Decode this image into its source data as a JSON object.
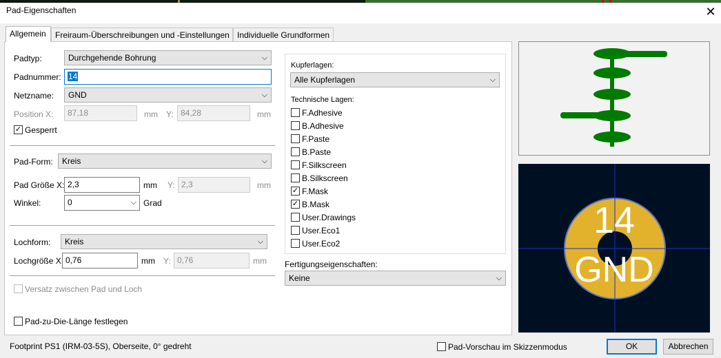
{
  "window": {
    "title": "Pad-Eigenschaften",
    "close_glyph": "✕"
  },
  "tabs": [
    {
      "label": "Allgemein",
      "active": true
    },
    {
      "label": "Freiraum-Überschreibungen und -Einstellungen",
      "active": false
    },
    {
      "label": "Individuelle Grundformen",
      "active": false
    }
  ],
  "general": {
    "padtyp_label": "Padtyp:",
    "padtyp_value": "Durchgehende Bohrung",
    "padnummer_label": "Padnummer:",
    "padnummer_value": "14",
    "netzname_label": "Netzname:",
    "netzname_value": "GND",
    "position_x_label": "Position X:",
    "position_x_value": "87,18",
    "position_x_unit": "mm",
    "position_y_label": "Y:",
    "position_y_value": "84,28",
    "position_y_unit": "mm",
    "gesperrt_label": "Gesperrt",
    "gesperrt_checked": true
  },
  "pad_shape": {
    "form_label": "Pad-Form:",
    "form_value": "Kreis",
    "size_x_label": "Pad Größe X:",
    "size_x_value": "2,3",
    "size_x_unit": "mm",
    "size_y_label": "Y:",
    "size_y_value": "2,3",
    "size_y_unit": "mm",
    "angle_label": "Winkel:",
    "angle_value": "0",
    "angle_unit": "Grad"
  },
  "hole": {
    "form_label": "Lochform:",
    "form_value": "Kreis",
    "size_x_label": "Lochgröße X:",
    "size_x_value": "0,76",
    "size_x_unit": "mm",
    "size_y_label": "Y:",
    "size_y_value": "0,76",
    "size_y_unit": "mm"
  },
  "offset": {
    "label": "Versatz zwischen Pad und Loch",
    "checked": false
  },
  "die_length": {
    "label": "Pad-zu-Die-Länge festlegen",
    "checked": false
  },
  "layers": {
    "copper_label": "Kupferlagen:",
    "copper_value": "Alle Kupferlagen",
    "technical_label": "Technische Lagen:",
    "items": [
      {
        "name": "F.Adhesive",
        "checked": false
      },
      {
        "name": "B.Adhesive",
        "checked": false
      },
      {
        "name": "F.Paste",
        "checked": false
      },
      {
        "name": "B.Paste",
        "checked": false
      },
      {
        "name": "F.Silkscreen",
        "checked": false
      },
      {
        "name": "B.Silkscreen",
        "checked": false
      },
      {
        "name": "F.Mask",
        "checked": true
      },
      {
        "name": "B.Mask",
        "checked": true
      },
      {
        "name": "User.Drawings",
        "checked": false
      },
      {
        "name": "User.Eco1",
        "checked": false
      },
      {
        "name": "User.Eco2",
        "checked": false
      }
    ]
  },
  "fab": {
    "label": "Fertigungseigenschaften:",
    "value": "Keine"
  },
  "preview": {
    "pad_number": "14",
    "net_name": "GND",
    "colors": {
      "pad": "#e2b22c",
      "background": "#001023",
      "crosshair": "#1e2dc8",
      "stack": "#007a00"
    }
  },
  "footer": {
    "info": "Footprint PS1 (IRM-03-5S), Oberseite, 0° gedreht",
    "sketch_label": "Pad-Vorschau im Skizzenmodus",
    "sketch_checked": false,
    "ok": "OK",
    "cancel": "Abbrechen"
  },
  "icons": {
    "dropdown": "chevron-down-icon",
    "check": "✓"
  }
}
